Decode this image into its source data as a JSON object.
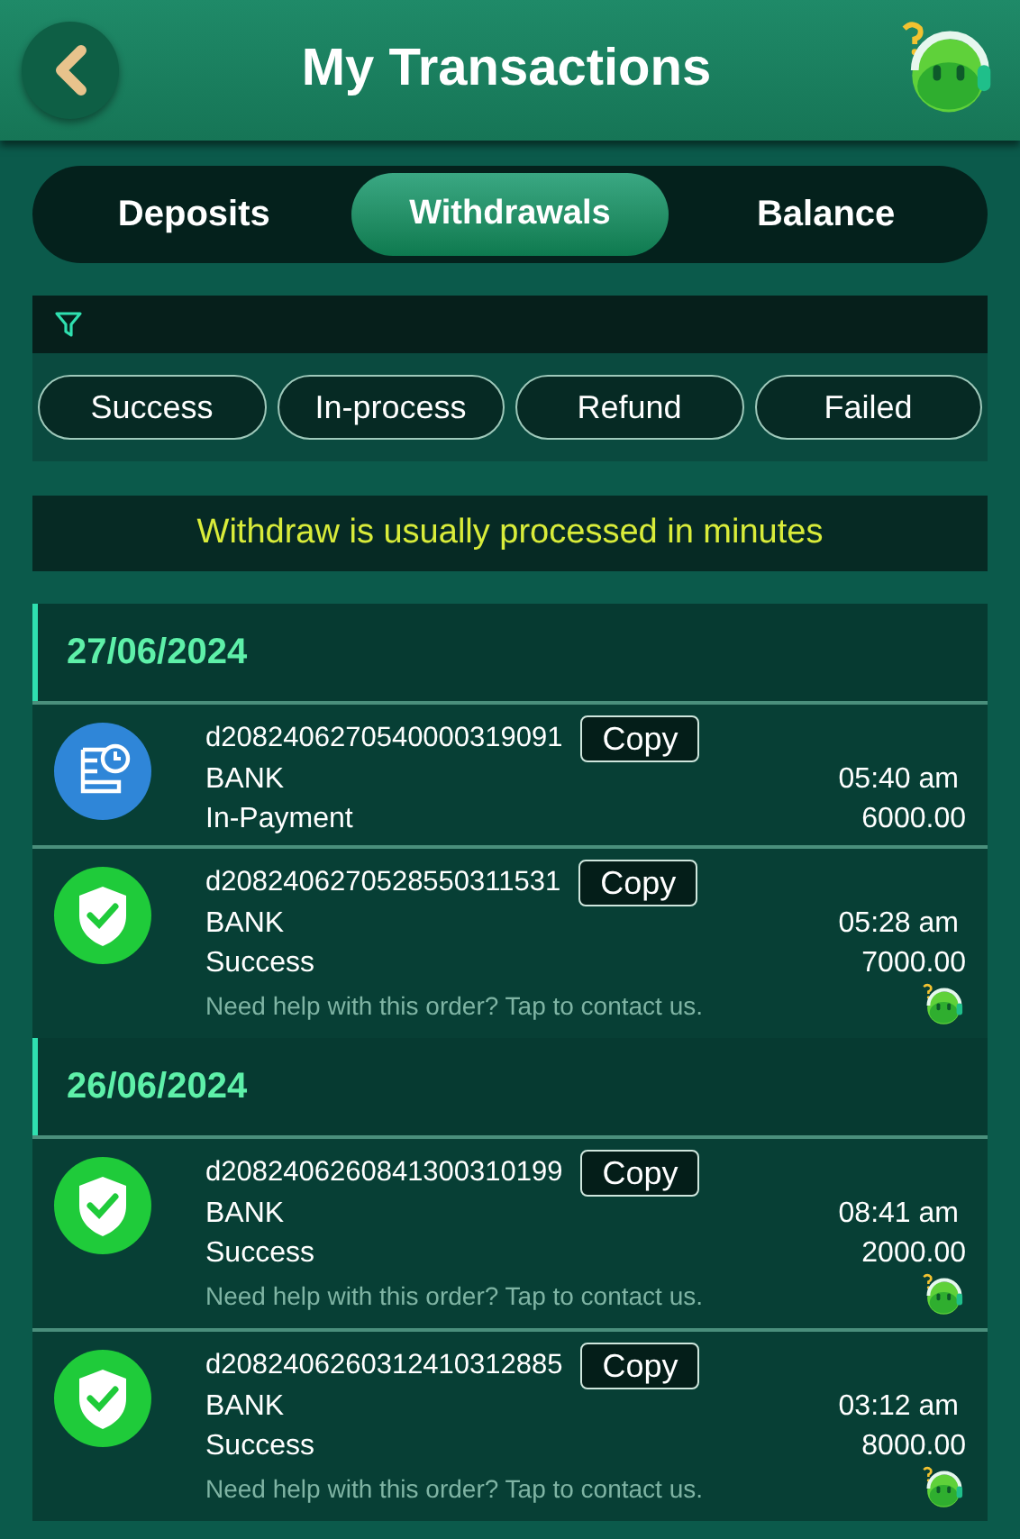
{
  "header": {
    "title": "My Transactions"
  },
  "tabs": [
    {
      "label": "Deposits",
      "selected": false
    },
    {
      "label": "Withdrawals",
      "selected": true
    },
    {
      "label": "Balance",
      "selected": false
    }
  ],
  "filters": [
    {
      "label": "Success",
      "selected": false
    },
    {
      "label": "In-process",
      "selected": false
    },
    {
      "label": "Refund",
      "selected": false
    },
    {
      "label": "Failed",
      "selected": false
    }
  ],
  "notice": "Withdraw is usually processed in minutes",
  "groups": [
    {
      "date": "27/06/2024",
      "transactions": [
        {
          "kind": "pending",
          "order_id": "d2082406270540000319091",
          "copy": "Copy",
          "method": "BANK",
          "status": "In-Payment",
          "time": "05:40 am",
          "amount": "6000.00"
        },
        {
          "kind": "success",
          "order_id": "d2082406270528550311531",
          "copy": "Copy",
          "method": "BANK",
          "status": "Success",
          "time": "05:28 am",
          "amount": "7000.00",
          "help": "Need help with this order? Tap to contact us."
        }
      ]
    },
    {
      "date": "26/06/2024",
      "transactions": [
        {
          "kind": "success",
          "order_id": "d2082406260841300310199",
          "copy": "Copy",
          "method": "BANK",
          "status": "Success",
          "time": "08:41 am",
          "amount": "2000.00",
          "help": "Need help with this order? Tap to contact us."
        },
        {
          "kind": "success",
          "order_id": "d2082406260312410312885",
          "copy": "Copy",
          "method": "BANK",
          "status": "Success",
          "time": "03:12 am",
          "amount": "8000.00",
          "help": "Need help with this order? Tap to contact us."
        }
      ]
    }
  ]
}
